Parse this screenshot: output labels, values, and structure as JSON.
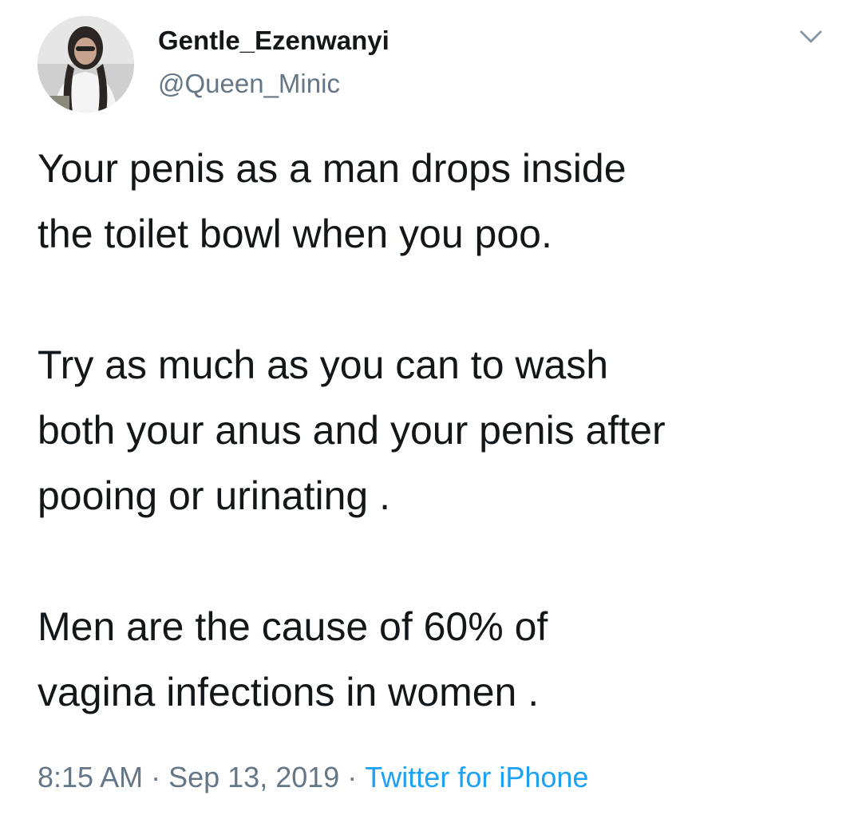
{
  "tweet": {
    "author": {
      "display_name": "Gentle_Ezenwanyi",
      "handle": "@Queen_Minic",
      "avatar_icon": "profile-photo"
    },
    "menu_icon": "chevron-down-icon",
    "paragraphs": [
      "Your penis as a man drops inside\nthe toilet bowl when you poo.",
      "Try as much as you can to wash\nboth your anus and your penis after\npooing or urinating .",
      "Men are the cause of 60% of\nvagina infections in women ."
    ],
    "time": "8:15 AM",
    "separator": "·",
    "date": "Sep 13, 2019",
    "source": "Twitter for iPhone"
  },
  "colors": {
    "text": "#14171a",
    "secondary": "#657786",
    "link": "#1da1f2"
  }
}
